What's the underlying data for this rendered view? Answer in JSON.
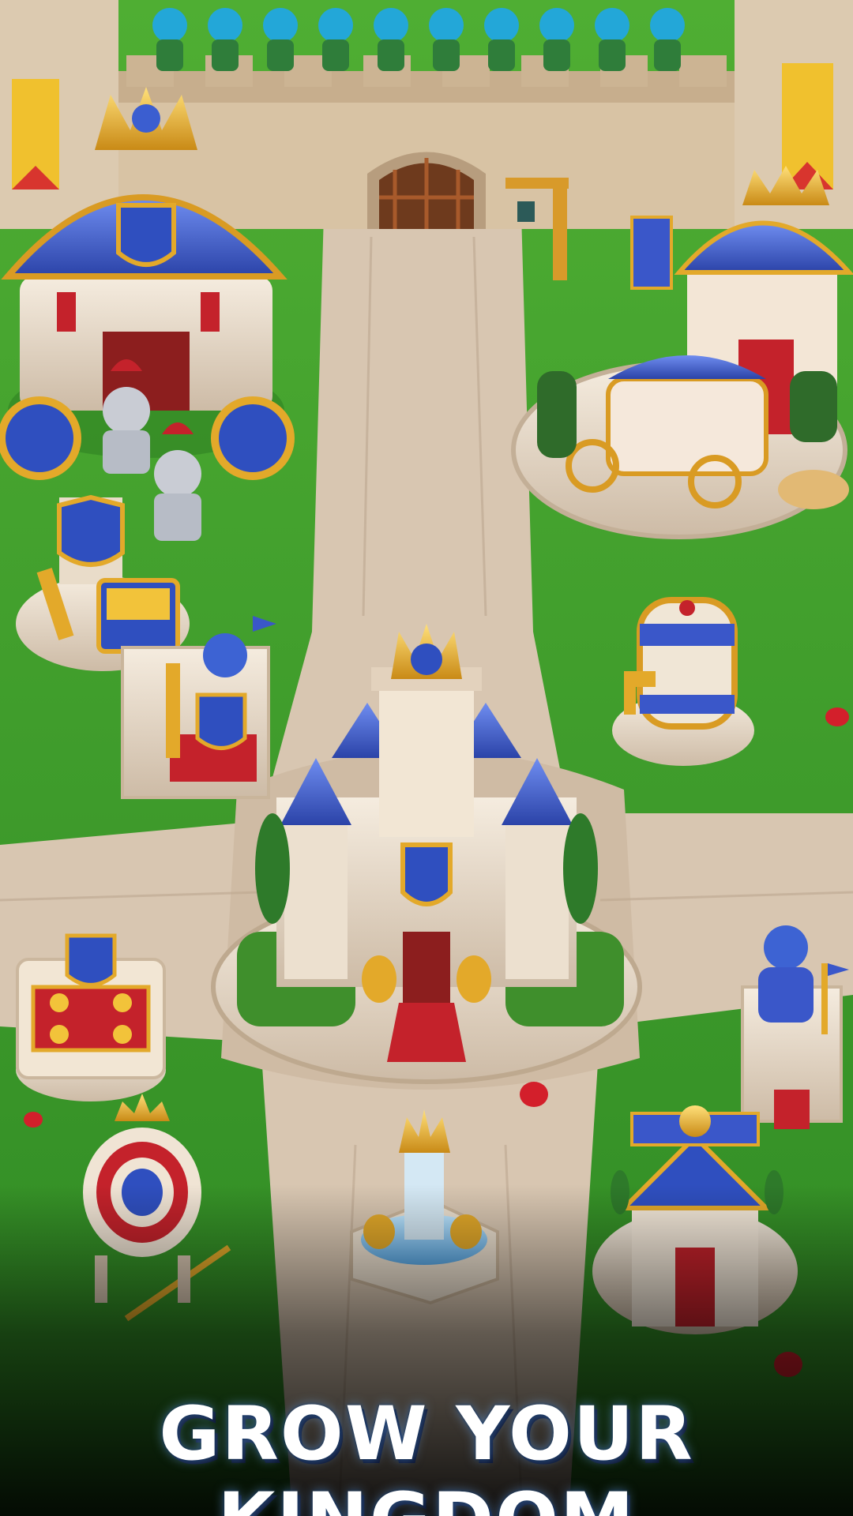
{
  "headline": {
    "text": "GROW YOUR KINGDOM"
  },
  "colors": {
    "grass": "#3f9a2d",
    "grass_light": "#5cb83e",
    "path": "#d9c7b3",
    "stone": "#e9dcc9",
    "roof_blue": "#3a57c9",
    "gold": "#e3a92a",
    "red_carpet": "#c4222b"
  },
  "buildings": [
    {
      "id": "castle-gate",
      "icon": "gate-icon"
    },
    {
      "id": "royal-carriage-hall",
      "icon": "crown-icon"
    },
    {
      "id": "royal-stable",
      "icon": "carriage-icon"
    },
    {
      "id": "treasury",
      "icon": "treasure-chest-icon"
    },
    {
      "id": "knight-shrine",
      "icon": "knight-icon"
    },
    {
      "id": "royal-keep",
      "icon": "castle-icon"
    },
    {
      "id": "wine-barrel",
      "icon": "barrel-icon"
    },
    {
      "id": "exchange-market",
      "icon": "scales-icon"
    },
    {
      "id": "archery-target",
      "icon": "target-icon"
    },
    {
      "id": "crown-fountain",
      "icon": "fountain-icon"
    },
    {
      "id": "guard-post",
      "icon": "knight-statue-icon"
    },
    {
      "id": "royal-bank",
      "icon": "bank-icon"
    }
  ]
}
